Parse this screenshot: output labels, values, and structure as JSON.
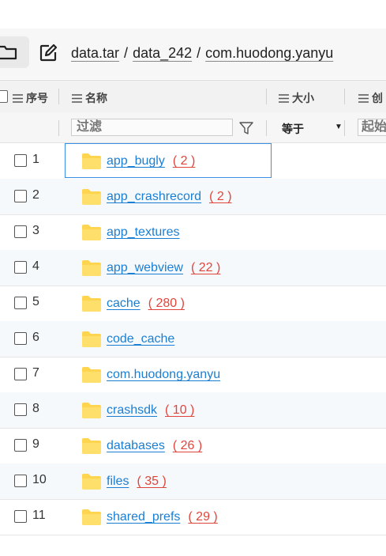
{
  "toolbar": {
    "breadcrumbs": [
      "data.tar",
      "data_242",
      "com.huodong.yanyu"
    ],
    "separator": "/"
  },
  "table": {
    "headers": {
      "index": "序号",
      "name": "名称",
      "size": "大小",
      "created": "创"
    },
    "filter": {
      "name_placeholder": "过滤",
      "size_operator": "等于",
      "created_placeholder": "起始"
    },
    "rows": [
      {
        "index": "1",
        "name": "app_bugly",
        "count": "( 2 )"
      },
      {
        "index": "2",
        "name": "app_crashrecord",
        "count": "( 2 )"
      },
      {
        "index": "3",
        "name": "app_textures",
        "count": ""
      },
      {
        "index": "4",
        "name": "app_webview",
        "count": "( 22 )"
      },
      {
        "index": "5",
        "name": "cache",
        "count": "( 280 )"
      },
      {
        "index": "6",
        "name": "code_cache",
        "count": ""
      },
      {
        "index": "7",
        "name": "com.huodong.yanyu",
        "count": ""
      },
      {
        "index": "8",
        "name": "crashsdk",
        "count": "( 10 )"
      },
      {
        "index": "9",
        "name": "databases",
        "count": "( 26 )"
      },
      {
        "index": "10",
        "name": "files",
        "count": "( 35 )"
      },
      {
        "index": "11",
        "name": "shared_prefs",
        "count": "( 29 )"
      }
    ]
  },
  "icons": {
    "folder": "folder-icon",
    "edit": "edit-icon",
    "filter": "filter-funnel-icon",
    "menu": "menu-lines-icon"
  },
  "colors": {
    "link": "#1a7fd4",
    "count": "#e0453b",
    "folder": "#ffd54f",
    "selection": "#3a8ee6"
  }
}
